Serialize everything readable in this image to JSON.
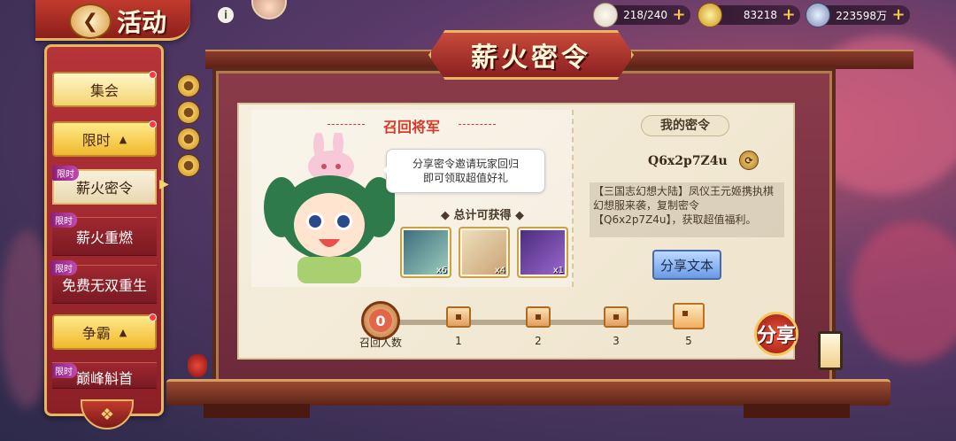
{
  "header": {
    "back_icon": "back-arrow-icon",
    "title": "活动",
    "info_icon": "info-icon"
  },
  "resources": [
    {
      "name": "stamina",
      "icon": "bun-icon",
      "value": "218/240"
    },
    {
      "name": "gold",
      "icon": "gold-ingot-icon",
      "value": "83218"
    },
    {
      "name": "silver",
      "icon": "coin-icon",
      "value": "223598万"
    }
  ],
  "sidebar": {
    "items": [
      {
        "type": "button",
        "label": "集会"
      },
      {
        "type": "category",
        "label": "限时",
        "arrow": "▲"
      },
      {
        "type": "item",
        "label": "薪火密令",
        "tag": "限时",
        "active": true
      },
      {
        "type": "item",
        "label": "薪火重燃",
        "tag": "限时"
      },
      {
        "type": "item",
        "label": "免费无双重生",
        "tag": "限时"
      },
      {
        "type": "category",
        "label": "争霸",
        "arrow": "▲"
      },
      {
        "type": "item",
        "label": "巅峰斛首",
        "tag": "限时"
      }
    ]
  },
  "banner": {
    "title": "薪火密令"
  },
  "recall": {
    "section_title": "召回将军",
    "bubble_line1": "分享密令邀请玩家回归",
    "bubble_line2": "即可领取超值好礼",
    "total_label": "总计可获得",
    "rewards": [
      {
        "icon": "green-token-icon",
        "count": "x6"
      },
      {
        "icon": "scroll-map-icon",
        "count": "x4"
      },
      {
        "icon": "purple-emblem-icon",
        "count": "x1"
      }
    ]
  },
  "my_code": {
    "title": "我的密令",
    "code": "Q6x2p7Z4u",
    "copy_icon": "copy-icon",
    "description": "【三国志幻想大陆】凤仪王元姬携执棋幻想服来袭，复制密令【Q6x2p7Z4u】，获取超值福利。",
    "share_text_button": "分享文本"
  },
  "progress": {
    "current": "0",
    "current_label": "召回人数",
    "milestones": [
      "1",
      "2",
      "3",
      "5"
    ]
  },
  "share_button": "分享",
  "colors": {
    "accent_red": "#d43a2a",
    "gold": "#e6b760",
    "panel_bg": "#f6efdf"
  }
}
